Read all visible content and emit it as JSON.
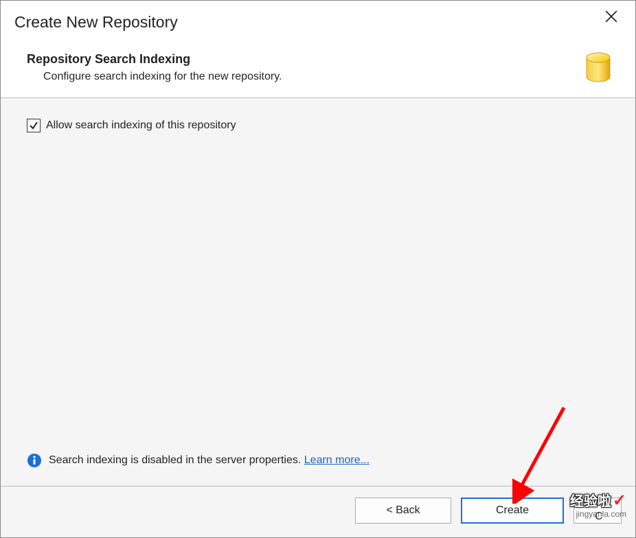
{
  "titlebar": {
    "title": "Create New Repository",
    "close_icon": "close"
  },
  "header": {
    "title": "Repository Search Indexing",
    "subtitle": "Configure search indexing for the new repository.",
    "icon": "database"
  },
  "content": {
    "checkbox_label": "Allow search indexing of this repository",
    "checkbox_checked": true,
    "info_text": "Search indexing is disabled in the server properties. ",
    "learn_more": "Learn more..."
  },
  "buttons": {
    "back": "< Back",
    "create": "Create",
    "cancel_partial": "C"
  },
  "watermark": {
    "main": "经验啦",
    "check": "✓",
    "url": "jingyanla.com"
  }
}
